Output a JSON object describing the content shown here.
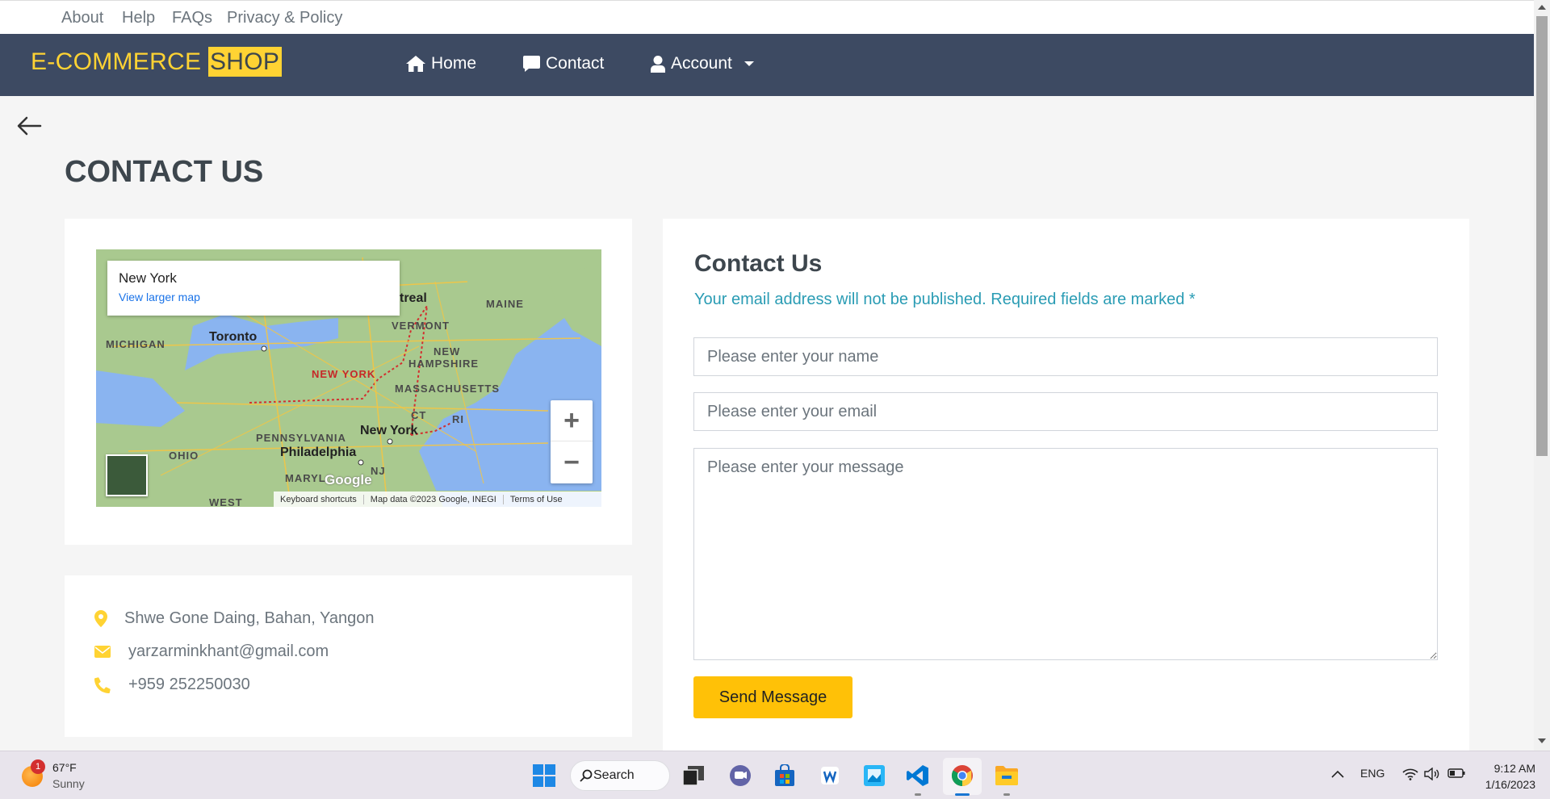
{
  "topbar": {
    "links": [
      "About",
      "Help",
      "FAQs",
      "Privacy & Policy"
    ]
  },
  "navbar": {
    "brand_main": "E-COMMERCE",
    "brand_highlight": "SHOP",
    "home": "Home",
    "contact": "Contact",
    "account": "Account"
  },
  "page": {
    "title": "CONTACT US"
  },
  "map": {
    "place": "New York",
    "larger_link": "View larger map",
    "labels": {
      "michigan": "MICHIGAN",
      "ohio": "OHIO",
      "pennsylvania": "PENNSYLVANIA",
      "new_york_state": "NEW YORK",
      "vermont": "VERMONT",
      "new_hampshire_1": "NEW",
      "new_hampshire_2": "HAMPSHIRE",
      "massachusetts": "MASSACHUSETTS",
      "maine": "MAINE",
      "ct": "CT",
      "ri": "RI",
      "nj": "NJ",
      "maryland": "MARYL",
      "west": "WEST",
      "toronto": "Toronto",
      "new_york_city": "New York",
      "philadelphia": "Philadelphia",
      "montreal": "treal"
    },
    "zoom_in": "+",
    "zoom_out": "−",
    "google": "Google",
    "footer": [
      "Keyboard shortcuts",
      "Map data ©2023 Google, INEGI",
      "Terms of Use"
    ]
  },
  "contact_info": {
    "address": "Shwe Gone Daing, Bahan, Yangon",
    "email": "yarzarminkhant@gmail.com",
    "phone": "+959 252250030"
  },
  "form": {
    "title": "Contact Us",
    "note": "Your email address will not be published. Required fields are marked *",
    "name_placeholder": "Please enter your name",
    "email_placeholder": "Please enter your email",
    "message_placeholder": "Please enter your message",
    "submit": "Send Message"
  },
  "taskbar": {
    "weather_badge": "1",
    "temperature": "67°F",
    "condition": "Sunny",
    "search": "Search",
    "language": "ENG",
    "time": "9:12 AM",
    "date": "1/16/2023"
  },
  "colors": {
    "accent": "#ffd333",
    "navbar": "#3d4a62",
    "button": "#ffc107",
    "note": "#2a9cb4"
  }
}
